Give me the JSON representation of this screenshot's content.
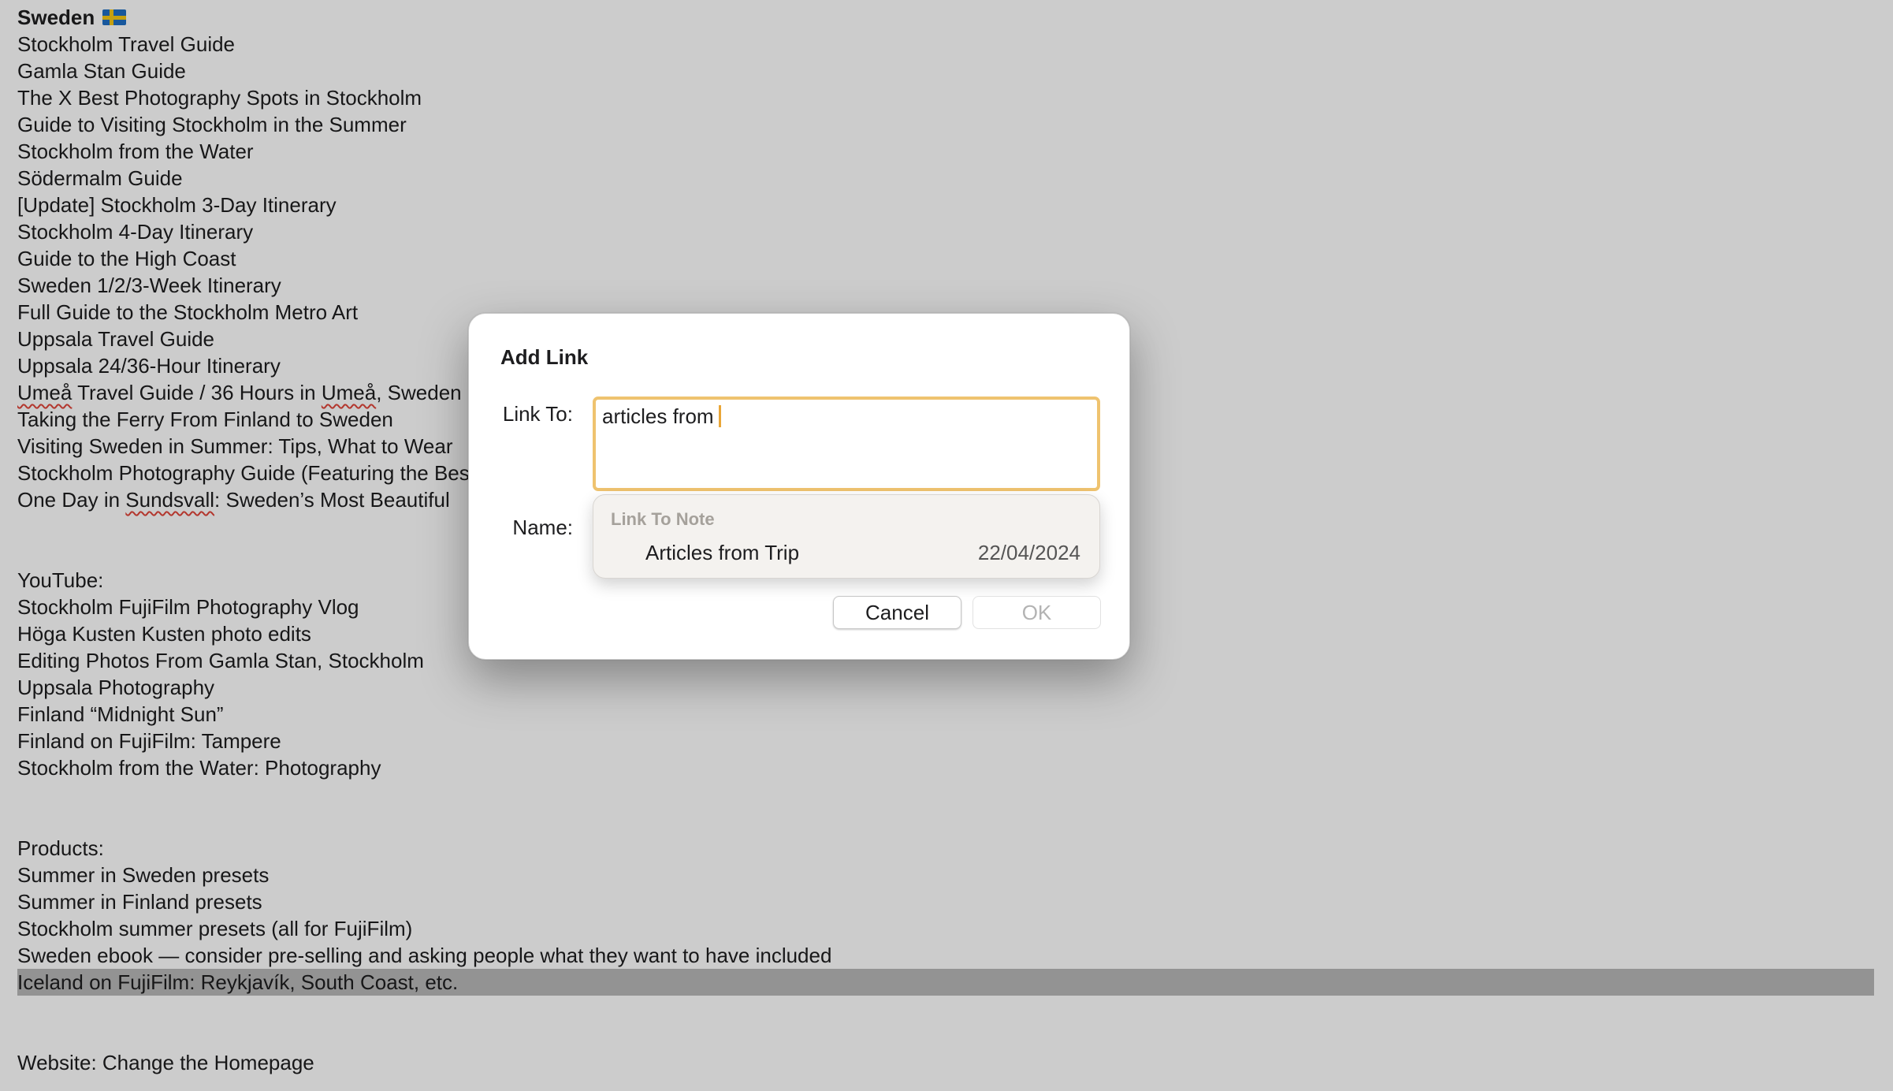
{
  "note": {
    "title": "Sweden",
    "title_icon": "swedish-flag-icon",
    "articles": [
      "Stockholm Travel Guide",
      "Gamla Stan Guide",
      "The X Best Photography Spots in Stockholm",
      "Guide to Visiting Stockholm in the Summer",
      "Stockholm from the Water",
      "Södermalm Guide",
      "[Update] Stockholm 3-Day Itinerary",
      "Stockholm 4-Day Itinerary",
      "Guide to the High Coast",
      "Sweden 1/2/3-Week Itinerary",
      "Full Guide to the Stockholm Metro Art",
      "Uppsala Travel Guide",
      "Uppsala 24/36-Hour Itinerary"
    ],
    "umea_line": {
      "word1": "Umeå",
      "mid": " Travel Guide / 36 Hours in ",
      "word2": "Umeå",
      "rest": ", Sweden"
    },
    "ferry": "Taking the Ferry From Finland to Sweden",
    "visiting": "Visiting Sweden in Summer: Tips, What to Wear",
    "photo_guide": "Stockholm Photography Guide (Featuring the Best",
    "sundsvall": {
      "pre": "One Day in ",
      "word": "Sundsvall",
      "rest": ": Sweden’s Most Beautiful"
    },
    "youtube_heading": "YouTube:",
    "youtube": [
      "Stockholm FujiFilm Photography Vlog",
      "Höga Kusten Kusten photo edits",
      "Editing Photos From Gamla Stan, Stockholm",
      "Uppsala Photography",
      "Finland “Midnight Sun”",
      "Finland on FujiFilm: Tampere",
      "Stockholm from the Water: Photography"
    ],
    "products_heading": "Products:",
    "products": [
      "Summer in Sweden presets",
      "Summer in Finland presets",
      "Stockholm summer presets (all for FujiFilm)",
      "Sweden ebook — consider pre-selling and asking people what they want to have included"
    ],
    "selected_line": "Iceland on FujiFilm: Reykjavík, South Coast, etc.",
    "website": "Website: Change the Homepage"
  },
  "dialog": {
    "title": "Add Link",
    "link_label": "Link To:",
    "link_value": "articles from",
    "name_label": "Name:",
    "suggestions": {
      "header": "Link To Note",
      "items": [
        {
          "label": "Articles from Trip",
          "date": "22/04/2024"
        }
      ]
    },
    "cancel_label": "Cancel",
    "ok_label": "OK"
  },
  "colors": {
    "focus_ring": "#efc36f",
    "caret": "#e9a638",
    "selection": "#b8b8b8",
    "spell_underline": "#e0453a"
  }
}
